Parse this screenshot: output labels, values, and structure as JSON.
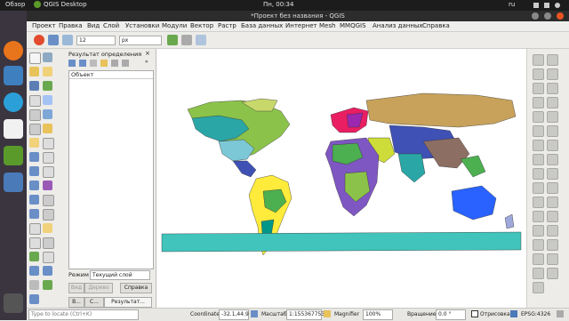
{
  "topbar": {
    "overview": "Обзор",
    "app": "QGIS Desktop",
    "clock": "Пн, 00:34",
    "lang": "ru"
  },
  "window": {
    "title": "*Проект без названия - QGIS"
  },
  "menu": [
    "Проект",
    "Правка",
    "Вид",
    "Слой",
    "Установки",
    "Модули",
    "Вектор",
    "Растр",
    "База данных",
    "Интернет",
    "Mesh",
    "MMQGIS",
    "Анализ данных",
    "Справка"
  ],
  "toolbar": {
    "size_value": "12",
    "unit_value": "px"
  },
  "identify": {
    "title": "Результат определения",
    "column_header": "Объект",
    "mode_label": "Режим",
    "mode_value": "Текущий слой",
    "view_label": "Вид",
    "tree_label": "Дерево",
    "help_label": "Справка",
    "tabs": [
      "В...",
      "С...",
      "Результат..."
    ]
  },
  "status": {
    "search_placeholder": "Type to locate (Ctrl+K)",
    "coordinate_label": "Coordinate",
    "coordinate_value": "-32.1,44.9",
    "scale_label": "Масштаб",
    "scale_value": "1:155367753",
    "magnifier_label": "Magnifier",
    "magnifier_value": "100%",
    "rotation_label": "Вращение",
    "rotation_value": "0.0 °",
    "render_label": "Отрисовка",
    "crs_label": "EPSG:4326"
  }
}
